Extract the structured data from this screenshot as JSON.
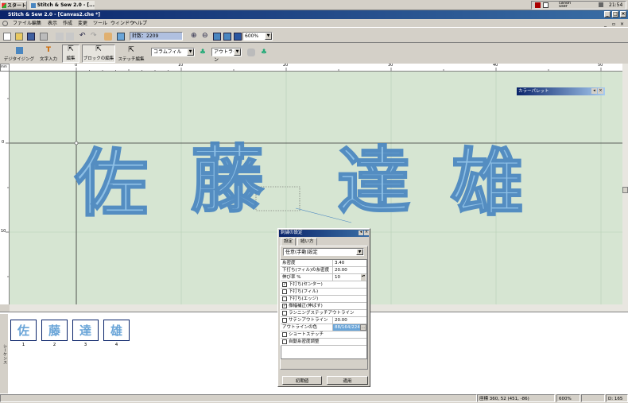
{
  "taskbar": {
    "start_label": "スタート",
    "task_label": "Stitch & Sew 2.0 - [...",
    "tray_user": "canon\nuser",
    "clock": "21:54"
  },
  "window": {
    "title": "Stitch & Sew 2.0 - [Canvas2.che *]"
  },
  "menu": [
    "ファイル",
    "編集",
    "表示",
    "作成",
    "変更",
    "ツール",
    "ウィンドウ",
    "ヘルプ"
  ],
  "toolbar1": {
    "stitch_count": "針数：2209",
    "zoom": "600%"
  },
  "toolbar2": {
    "buttons": [
      "デジタイジング",
      "文字入力",
      "編集",
      "ブロックの編集",
      "ステッチ編集"
    ],
    "fill_type": "コラムフィル",
    "outline_type": "アウトライン"
  },
  "rulers": {
    "h_ticks": [
      "0",
      "10",
      "20",
      "30",
      "40",
      "50"
    ],
    "v_ticks": [
      "0",
      "10"
    ],
    "corner": "mm"
  },
  "canvas": {
    "text": "佐藤達雄",
    "characters": [
      "佐",
      "藤",
      "達",
      "雄"
    ]
  },
  "palette": {
    "title": "カラーパレット"
  },
  "dialog": {
    "title": "刺繍の設定",
    "tabs": [
      "設定",
      "縫い方"
    ],
    "mode": "任意(手動)設定",
    "rows": [
      {
        "label": "糸密度",
        "value": "3.40"
      },
      {
        "label": "下打ち(フィル)の糸密度",
        "value": "20.00"
      },
      {
        "label": "伸び率 %",
        "value": "10"
      }
    ],
    "checks": [
      {
        "label": "下打ち(センター)",
        "checked": true
      },
      {
        "label": "下打ち(フィル)",
        "checked": false
      },
      {
        "label": "下打ち(エッジ)",
        "checked": false
      },
      {
        "label": "振幅補正(伸ばす)",
        "checked": true
      },
      {
        "label": "ランニングステッチアウトライン",
        "checked": false
      },
      {
        "label": "サテンアウトライン",
        "checked": false,
        "value": "20.00"
      }
    ],
    "outline_color_label": "アウトラインの色",
    "outline_color_value": "88/164/224",
    "checks2": [
      {
        "label": "ショートステッチ",
        "checked": false
      },
      {
        "label": "自動糸密度調整",
        "checked": false
      }
    ],
    "reset_button": "初期値",
    "apply_button": "適用"
  },
  "sequence": {
    "side_label": "シーケンス",
    "items": [
      {
        "num": "1",
        "char": "佐"
      },
      {
        "num": "2",
        "char": "藤"
      },
      {
        "num": "3",
        "char": "達"
      },
      {
        "num": "4",
        "char": "雄"
      }
    ]
  },
  "status": {
    "coords": "座標  360, 52  (451, -86)",
    "zoom": "600%",
    "d": "D: 165"
  },
  "colors": {
    "title_blue": "#0a246a",
    "canvas_bg": "#d6e5d2",
    "stitch_blue": "#88bde8"
  }
}
